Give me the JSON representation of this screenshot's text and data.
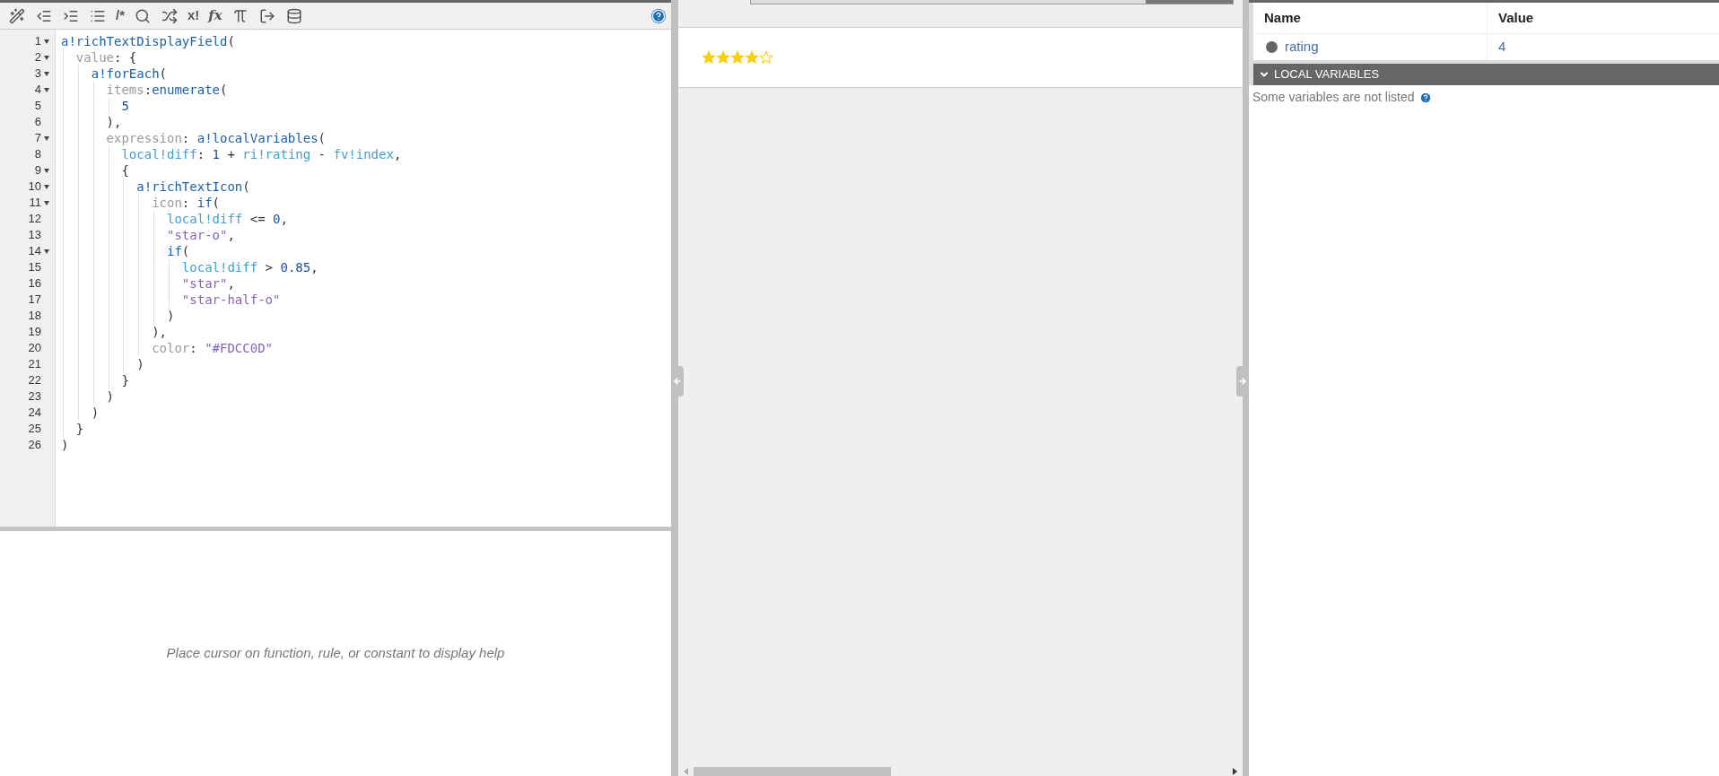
{
  "toolbar": {
    "buttons": [
      {
        "kind": "wand"
      },
      {
        "kind": "outdent"
      },
      {
        "kind": "indent"
      },
      {
        "kind": "list"
      },
      {
        "kind": "text",
        "label": "/*"
      },
      {
        "kind": "search"
      },
      {
        "kind": "shuffle"
      },
      {
        "kind": "text",
        "label": "x!"
      },
      {
        "kind": "italic",
        "label": "fx"
      },
      {
        "kind": "pi"
      },
      {
        "kind": "export"
      },
      {
        "kind": "database"
      },
      {
        "kind": "help"
      }
    ]
  },
  "editor": {
    "lines": [
      {
        "number": "1",
        "fold": true,
        "tokens": [
          {
            "kind": "func",
            "text": "a!richTextDisplayField"
          },
          {
            "kind": "punct",
            "text": "("
          }
        ]
      },
      {
        "number": "2",
        "fold": true,
        "tokens": [
          {
            "kind": "key",
            "text": "  value"
          },
          {
            "kind": "punct",
            "text": ": {"
          }
        ]
      },
      {
        "number": "3",
        "fold": true,
        "tokens": [
          {
            "kind": "func",
            "text": "    a!forEach"
          },
          {
            "kind": "punct",
            "text": "("
          }
        ]
      },
      {
        "number": "4",
        "fold": true,
        "tokens": [
          {
            "kind": "key",
            "text": "      items"
          },
          {
            "kind": "punct",
            "text": ":"
          },
          {
            "kind": "func",
            "text": "enumerate"
          },
          {
            "kind": "punct",
            "text": "("
          }
        ]
      },
      {
        "number": "5",
        "fold": false,
        "tokens": [
          {
            "kind": "num",
            "text": "        5"
          }
        ]
      },
      {
        "number": "6",
        "fold": false,
        "tokens": [
          {
            "kind": "punct",
            "text": "      ),"
          }
        ]
      },
      {
        "number": "7",
        "fold": true,
        "tokens": [
          {
            "kind": "key",
            "text": "      expression"
          },
          {
            "kind": "punct",
            "text": ": "
          },
          {
            "kind": "func",
            "text": "a!localVariables"
          },
          {
            "kind": "punct",
            "text": "("
          }
        ]
      },
      {
        "number": "8",
        "fold": false,
        "tokens": [
          {
            "kind": "var",
            "text": "        local!diff"
          },
          {
            "kind": "punct",
            "text": ": "
          },
          {
            "kind": "num",
            "text": "1"
          },
          {
            "kind": "punct",
            "text": " + "
          },
          {
            "kind": "var",
            "text": "ri!rating"
          },
          {
            "kind": "punct",
            "text": " - "
          },
          {
            "kind": "var",
            "text": "fv!index"
          },
          {
            "kind": "punct",
            "text": ","
          }
        ]
      },
      {
        "number": "9",
        "fold": true,
        "tokens": [
          {
            "kind": "punct",
            "text": "        {"
          }
        ]
      },
      {
        "number": "10",
        "fold": true,
        "tokens": [
          {
            "kind": "func",
            "text": "          a!richTextIcon"
          },
          {
            "kind": "punct",
            "text": "("
          }
        ]
      },
      {
        "number": "11",
        "fold": true,
        "tokens": [
          {
            "kind": "key",
            "text": "            icon"
          },
          {
            "kind": "punct",
            "text": ": "
          },
          {
            "kind": "func",
            "text": "if"
          },
          {
            "kind": "punct",
            "text": "("
          }
        ]
      },
      {
        "number": "12",
        "fold": false,
        "tokens": [
          {
            "kind": "var",
            "text": "              local!diff"
          },
          {
            "kind": "punct",
            "text": " <= "
          },
          {
            "kind": "num",
            "text": "0"
          },
          {
            "kind": "punct",
            "text": ","
          }
        ]
      },
      {
        "number": "13",
        "fold": false,
        "tokens": [
          {
            "kind": "str",
            "text": "              \"star-o\""
          },
          {
            "kind": "punct",
            "text": ","
          }
        ]
      },
      {
        "number": "14",
        "fold": true,
        "tokens": [
          {
            "kind": "func",
            "text": "              if"
          },
          {
            "kind": "punct",
            "text": "("
          }
        ]
      },
      {
        "number": "15",
        "fold": false,
        "tokens": [
          {
            "kind": "var",
            "text": "                local!diff"
          },
          {
            "kind": "punct",
            "text": " > "
          },
          {
            "kind": "num",
            "text": "0.85"
          },
          {
            "kind": "punct",
            "text": ","
          }
        ]
      },
      {
        "number": "16",
        "fold": false,
        "tokens": [
          {
            "kind": "str",
            "text": "                \"star\""
          },
          {
            "kind": "punct",
            "text": ","
          }
        ]
      },
      {
        "number": "17",
        "fold": false,
        "tokens": [
          {
            "kind": "str",
            "text": "                \"star-half-o\""
          }
        ]
      },
      {
        "number": "18",
        "fold": false,
        "tokens": [
          {
            "kind": "punct",
            "text": "              )"
          }
        ]
      },
      {
        "number": "19",
        "fold": false,
        "tokens": [
          {
            "kind": "punct",
            "text": "            ),"
          }
        ]
      },
      {
        "number": "20",
        "fold": false,
        "tokens": [
          {
            "kind": "key",
            "text": "            color"
          },
          {
            "kind": "punct",
            "text": ": "
          },
          {
            "kind": "str",
            "text": "\"#FDCC0D\""
          }
        ]
      },
      {
        "number": "21",
        "fold": false,
        "tokens": [
          {
            "kind": "punct",
            "text": "          )"
          }
        ]
      },
      {
        "number": "22",
        "fold": false,
        "tokens": [
          {
            "kind": "punct",
            "text": "        }"
          }
        ]
      },
      {
        "number": "23",
        "fold": false,
        "tokens": [
          {
            "kind": "punct",
            "text": "      )"
          }
        ]
      },
      {
        "number": "24",
        "fold": false,
        "tokens": [
          {
            "kind": "punct",
            "text": "    )"
          }
        ]
      },
      {
        "number": "25",
        "fold": false,
        "tokens": [
          {
            "kind": "punct",
            "text": "  }"
          }
        ]
      },
      {
        "number": "26",
        "fold": false,
        "tokens": [
          {
            "kind": "punct",
            "text": ")"
          }
        ]
      }
    ]
  },
  "help_panel": {
    "message": "Place cursor on function, rule, or constant to display help"
  },
  "preview": {
    "stars": 4
  },
  "test_inputs": {
    "columns": [
      "Name",
      "Value"
    ],
    "rows": [
      {
        "name": "rating",
        "value": "4"
      }
    ]
  },
  "local_variables": {
    "title": "LOCAL VARIABLES",
    "expanded": true,
    "note": "Some variables are not listed"
  }
}
